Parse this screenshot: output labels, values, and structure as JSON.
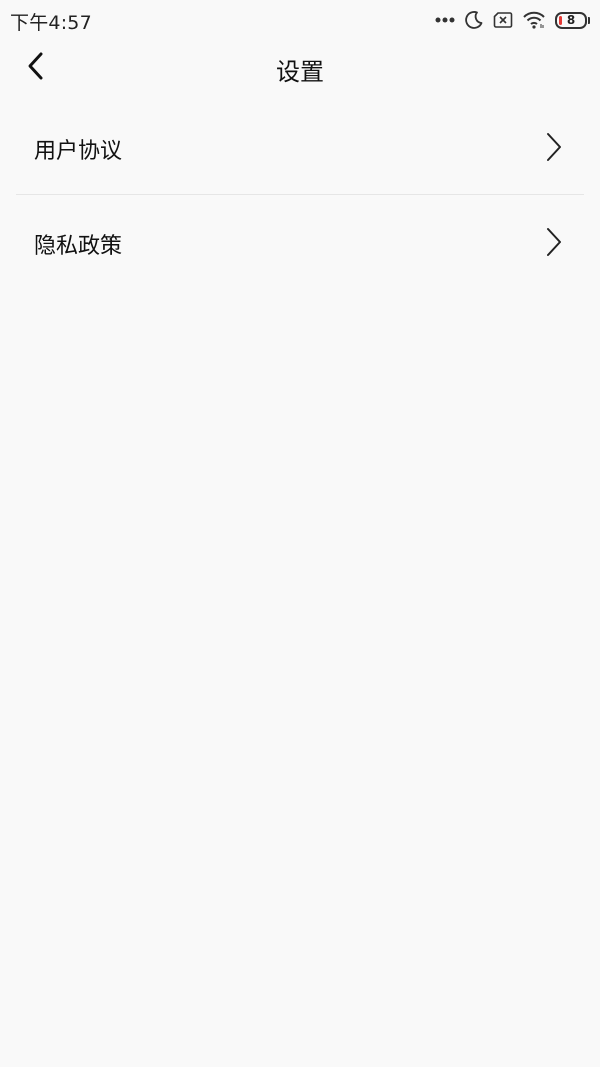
{
  "status_bar": {
    "time": "下午4:57",
    "battery_level": "8",
    "battery_low_color": "#e53935",
    "icons": [
      "more-dots-icon",
      "moon-icon",
      "sim-none-icon",
      "wifi-icon",
      "battery-icon"
    ]
  },
  "header": {
    "title": "设置",
    "back_icon": "chevron-left-icon"
  },
  "settings": {
    "items": [
      {
        "label": "用户协议",
        "icon": "chevron-right-icon"
      },
      {
        "label": "隐私政策",
        "icon": "chevron-right-icon"
      }
    ]
  },
  "colors": {
    "background": "#f9f9f9",
    "divider": "#e6e6e6",
    "text": "#111111"
  }
}
